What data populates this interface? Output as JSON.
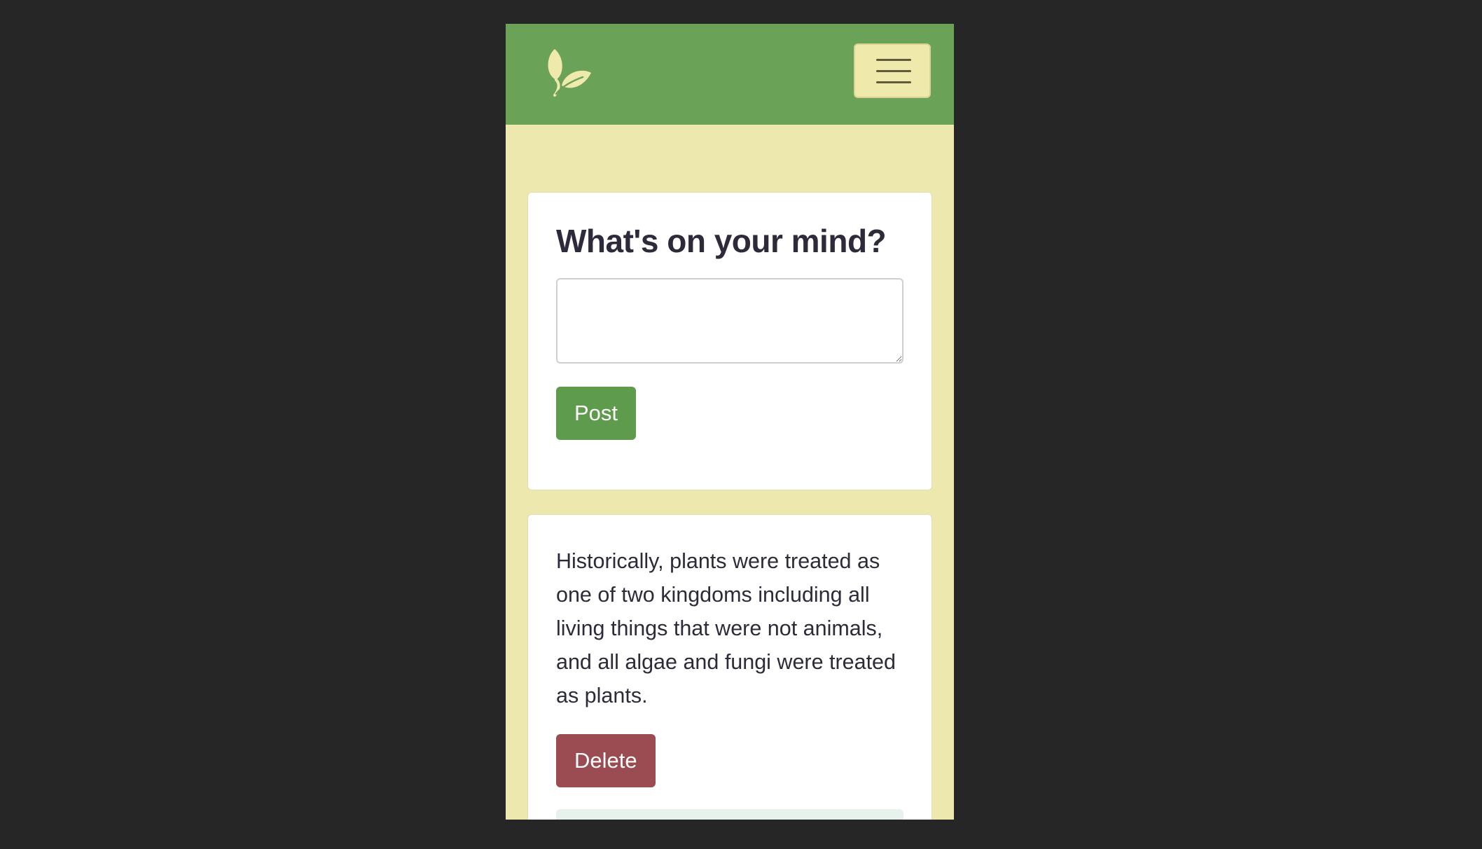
{
  "navbar": {
    "logo_icon": "leaf-icon",
    "menu_icon": "hamburger-menu-icon",
    "colors": {
      "background": "#6aa257",
      "logo": "#f0e9ac"
    }
  },
  "compose": {
    "title": "What's on your mind?",
    "input_value": "",
    "post_label": "Post"
  },
  "posts": [
    {
      "text": "Historically, plants were treated as one of two kingdoms including all living things that were not animals, and all algae and fungi were treated as plants.",
      "delete_label": "Delete"
    }
  ],
  "colors": {
    "page_background": "#ede8ad",
    "post_button": "#5e9b4c",
    "delete_button": "#9a4c52"
  }
}
